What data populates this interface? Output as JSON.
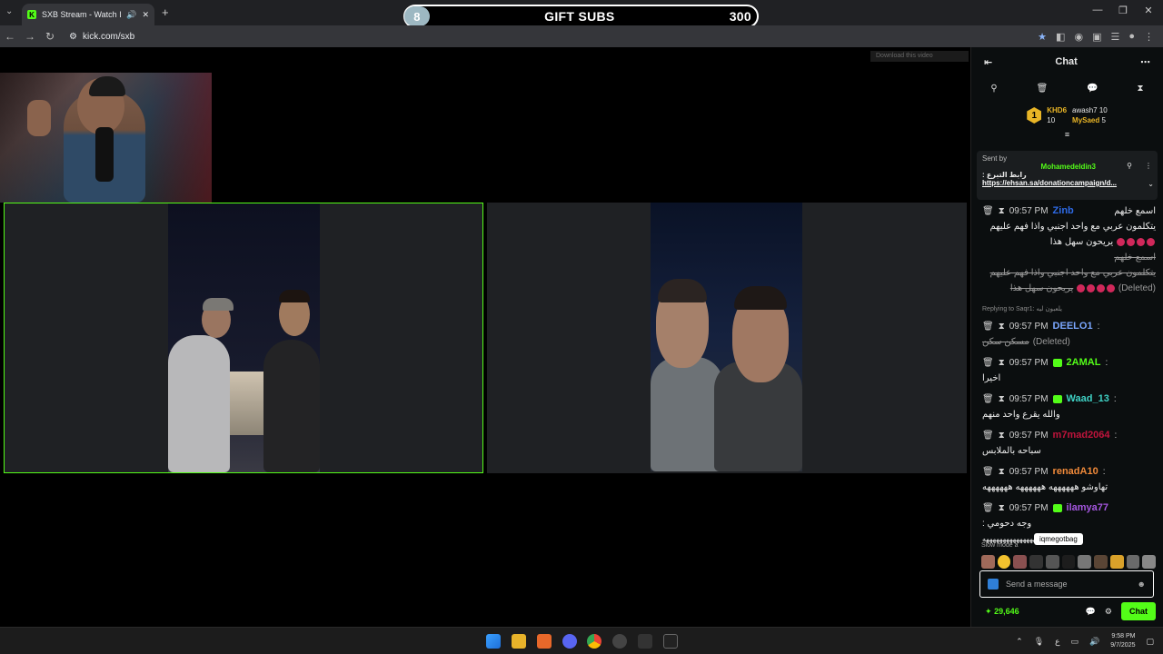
{
  "browser": {
    "tab_title": "SXB Stream - Watch Live o",
    "url": "kick.com/sxb"
  },
  "gift_subs": {
    "level": "8",
    "label": "GIFT SUBS",
    "count": "300"
  },
  "video": {
    "download_hint": "Download this video"
  },
  "chat": {
    "title": "Chat",
    "leaderboard": {
      "first": {
        "rank": "1",
        "name": "KHD6",
        "count": "10"
      },
      "second": {
        "name": "awash7",
        "count": "10"
      },
      "third": {
        "name": "MySaed",
        "count": "5"
      }
    },
    "pinned": {
      "label": "Sent by",
      "user": "Mohamedeldin3",
      "line1": "رابط التبرع :",
      "line2": "https://ehsan.sa/donationcampaign/d..."
    },
    "messages": [
      {
        "time": "09:57 PM",
        "user": "Zinb",
        "color": "#2e6ae6",
        "lines": [
          "اسمع خلهم",
          "يتكلمون عربي مع واحد اجنبي واذا فهم عليهم",
          "يريحون سهل هذا"
        ],
        "strike_lines": [
          "اسمع خلهم",
          "يتكلمون عربي مع واحد اجنبي واذا فهم عليهم",
          "يريحون سهل هذا"
        ],
        "deleted": "(Deleted)"
      },
      {
        "reply": "Replying to Saqr1: يلعبون ليه",
        "time": "09:57 PM",
        "user": "DEELO1",
        "color": "#7ba7ff",
        "text": "مسكن سكن",
        "deleted": "(Deleted)"
      },
      {
        "time": "09:57 PM",
        "user": "2AMAL",
        "color": "#53fc18",
        "text": "اخيرا"
      },
      {
        "time": "09:57 PM",
        "user": "Waad_13",
        "color": "#3fd1c4",
        "text": "والله يقرع واحد منهم"
      },
      {
        "time": "09:57 PM",
        "user": "m7mad2064",
        "color": "#c0143c",
        "text": "سباحه بالملابس"
      },
      {
        "time": "09:57 PM",
        "user": "renadA10",
        "color": "#f18a3a",
        "text": "تهاوشو ههههههه ههههههه ههههههه"
      },
      {
        "time": "09:57 PM",
        "user": "ilamya77",
        "color": "#a557e0",
        "text": "وجه دحومي :",
        "extra": "ههههههههههههههههههههههه"
      }
    ],
    "slow_mode": "Slow mode a",
    "tooltip": "iqmegotbag",
    "input_placeholder": "Send a message",
    "points": "29,646",
    "send_label": "Chat"
  },
  "taskbar": {
    "time": "9:58 PM",
    "date": "9/7/2025"
  }
}
